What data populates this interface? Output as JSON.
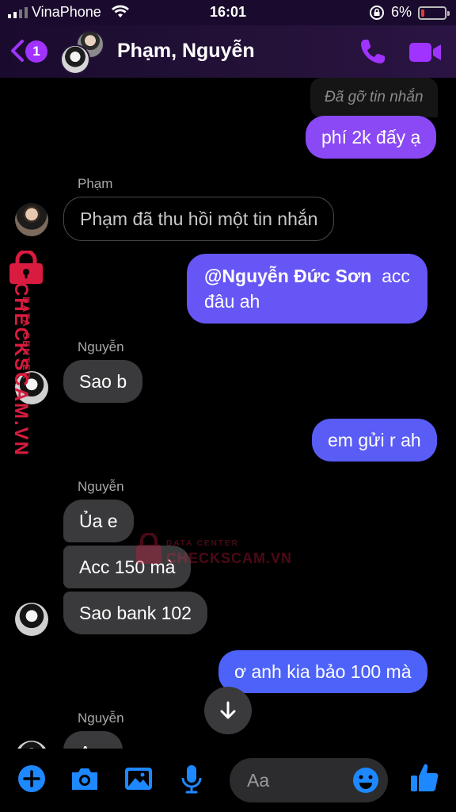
{
  "status_bar": {
    "carrier": "VinaPhone",
    "time": "16:01",
    "battery_percent": "6%",
    "battery_level": 0.06
  },
  "header": {
    "back_badge": "1",
    "title": "Phạm, Nguyễn",
    "accent_color": "#a033ff"
  },
  "messages": [
    {
      "type": "removed",
      "side": "out",
      "text": "Đã gỡ tin nhắn"
    },
    {
      "type": "text",
      "side": "out",
      "text": "phí 2k đấy ạ",
      "color": "#8a49f5"
    },
    {
      "type": "notice",
      "side": "in",
      "sender": "Phạm",
      "text": "Phạm đã thu hồi một tin nhắn"
    },
    {
      "type": "text",
      "side": "out",
      "mention": "@Nguyễn Đức Sơn",
      "text_line1": "acc",
      "text_line2": "đâu ah",
      "color": "#6656f5"
    },
    {
      "type": "text",
      "side": "in",
      "sender": "Nguyễn",
      "text": "Sao b"
    },
    {
      "type": "text",
      "side": "out",
      "text": "em gửi r ah",
      "color": "#5a5cf6"
    },
    {
      "type": "text",
      "side": "in",
      "sender": "Nguyễn",
      "text": "Ủa e"
    },
    {
      "type": "text",
      "side": "in",
      "text": "Acc 150 mà"
    },
    {
      "type": "text",
      "side": "in",
      "text": "Sao bank 102"
    },
    {
      "type": "text",
      "side": "out",
      "text": "ơ anh kia bảo 100 mà",
      "color": "#4d62f8"
    },
    {
      "type": "text",
      "side": "in",
      "sender": "Nguyễn",
      "text": "A..."
    }
  ],
  "watermark": {
    "text": "CHECKSCAM.VN",
    "subtext": "DATA CENTER",
    "color": "#d81b3f"
  },
  "composer": {
    "placeholder": "Aa",
    "accent_color": "#1e88ff"
  },
  "icons": [
    "signal-icon",
    "wifi-icon",
    "rotation-lock-icon",
    "battery-icon",
    "back-chevron-icon",
    "phone-icon",
    "video-icon",
    "arrow-down-icon",
    "plus-icon",
    "camera-icon",
    "image-icon",
    "microphone-icon",
    "emoji-icon",
    "thumbs-up-icon",
    "lock-icon"
  ]
}
